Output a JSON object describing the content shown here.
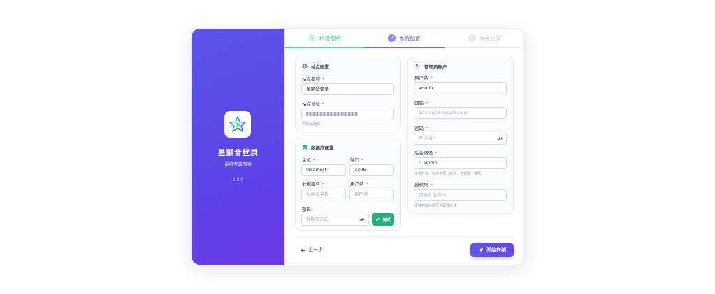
{
  "brand": {
    "name": "星聚合登录",
    "subtitle": "系统安装向导",
    "version": "1.0.0"
  },
  "steps": [
    {
      "num": "1",
      "label": "环境检测"
    },
    {
      "num": "2",
      "label": "系统配置"
    },
    {
      "num": "3",
      "label": "安装完成"
    }
  ],
  "site": {
    "title": "站点配置",
    "name_label": "站点名称",
    "name_value": "星聚合登录",
    "url_label": "站点地址",
    "url_hint": "不要以/结尾"
  },
  "db": {
    "title": "数据库配置",
    "host_label": "主机",
    "host_value": "localhost",
    "port_label": "端口",
    "port_value": "3306",
    "dbname_label": "数据库名",
    "dbname_placeholder": "数据库名称",
    "user_label": "用户名",
    "user_placeholder": "用户名",
    "password_label": "密码",
    "password_placeholder": "数据库密码",
    "test_label": "测试"
  },
  "admin": {
    "title": "管理员账户",
    "username_label": "用户名",
    "username_value": "admin",
    "email_label": "邮箱",
    "email_placeholder": "admin@example.com",
    "password_label": "密码",
    "password_placeholder": "至少6位",
    "path_label": "后台路径",
    "path_prefix": "/",
    "path_value": "admin",
    "path_hint": "字母开头，支持字母、数字、下划线、横线",
    "auth_label": "授权码",
    "auth_placeholder": "请输入授权码",
    "auth_hint": "安装完成后将写入配置文件"
  },
  "footer": {
    "back_label": "上一步",
    "start_label": "开始安装"
  },
  "colors": {
    "primary": "#5b55e9",
    "success": "#22b07d",
    "required": "#ef4444"
  }
}
